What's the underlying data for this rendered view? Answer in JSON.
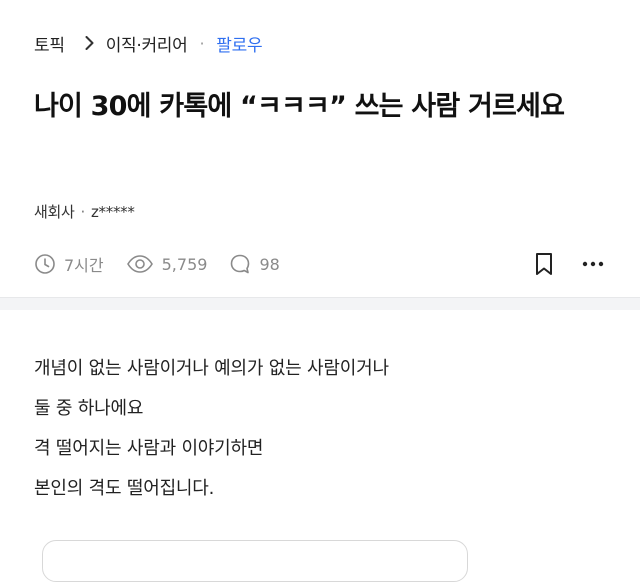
{
  "breadcrumb": {
    "topic": "토픽",
    "category": "이직·커리어",
    "separator": "·",
    "follow": "팔로우"
  },
  "post": {
    "title": "나이 30에 카톡에 “ㅋㅋㅋ” 쓰는 사람 거르세요",
    "author": {
      "company": "새회사",
      "separator": "·",
      "nickname": "z*****"
    },
    "stats": {
      "time": "7시간",
      "views": "5,759",
      "comments": "98"
    },
    "body_lines": [
      "개념이 없는 사람이거나 예의가 없는 사람이거나",
      "둘 중 하나에요",
      "격 떨어지는 사람과 이야기하면",
      "본인의 격도 떨어집니다."
    ]
  },
  "icons": {
    "breadcrumb_chevron": "chevron-right-icon",
    "time": "clock-icon",
    "views": "eye-icon",
    "comments": "comment-bubble-icon",
    "bookmark": "bookmark-icon",
    "more": "more-horizontal-icon"
  },
  "colors": {
    "follow_link": "#2f6ff0",
    "meta_gray": "#8a8a8a",
    "divider": "#f3f4f6"
  }
}
